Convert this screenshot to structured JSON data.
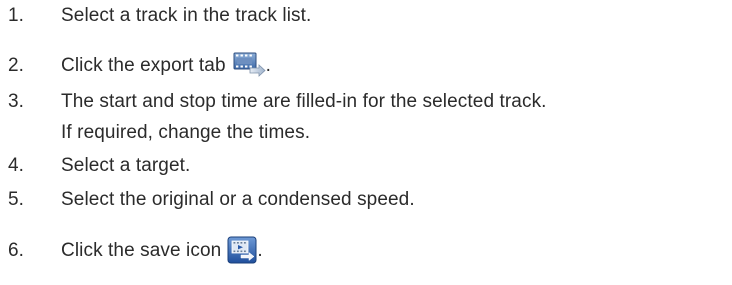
{
  "steps": [
    {
      "number": "1.",
      "text": "Select a track in the track list."
    },
    {
      "number": "2.",
      "text": "Click the export tab",
      "suffix": ".",
      "icon": "export-tab-icon"
    },
    {
      "number": "3.",
      "text": "The start and stop time are filled-in for the selected track.",
      "continuation": "If required, change the times."
    },
    {
      "number": "4.",
      "text": "Select a target."
    },
    {
      "number": "5.",
      "text": "Select the original or a condensed speed."
    },
    {
      "number": "6.",
      "text": "Click the save icon",
      "suffix": ".",
      "icon": "save-icon"
    }
  ]
}
